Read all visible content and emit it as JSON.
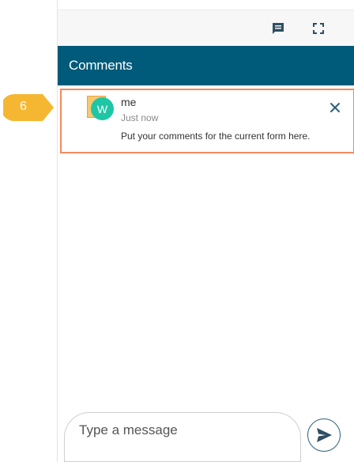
{
  "toolbar": {
    "comments_icon": "comment-icon",
    "expand_icon": "fullscreen-icon"
  },
  "panel": {
    "title": "Comments"
  },
  "comment": {
    "avatar_letter": "W",
    "author": "me",
    "time": "Just now",
    "text": "Put your comments for the current form here.",
    "close_icon": "close-icon"
  },
  "composer": {
    "placeholder": "Type a message",
    "send_icon": "send-icon"
  },
  "annotation": {
    "step_number": "6"
  },
  "colors": {
    "header_bg": "#005a79",
    "avatar_bg": "#1fc6a6",
    "highlight_border": "#f08b5d",
    "step_marker": "#f5b731"
  }
}
